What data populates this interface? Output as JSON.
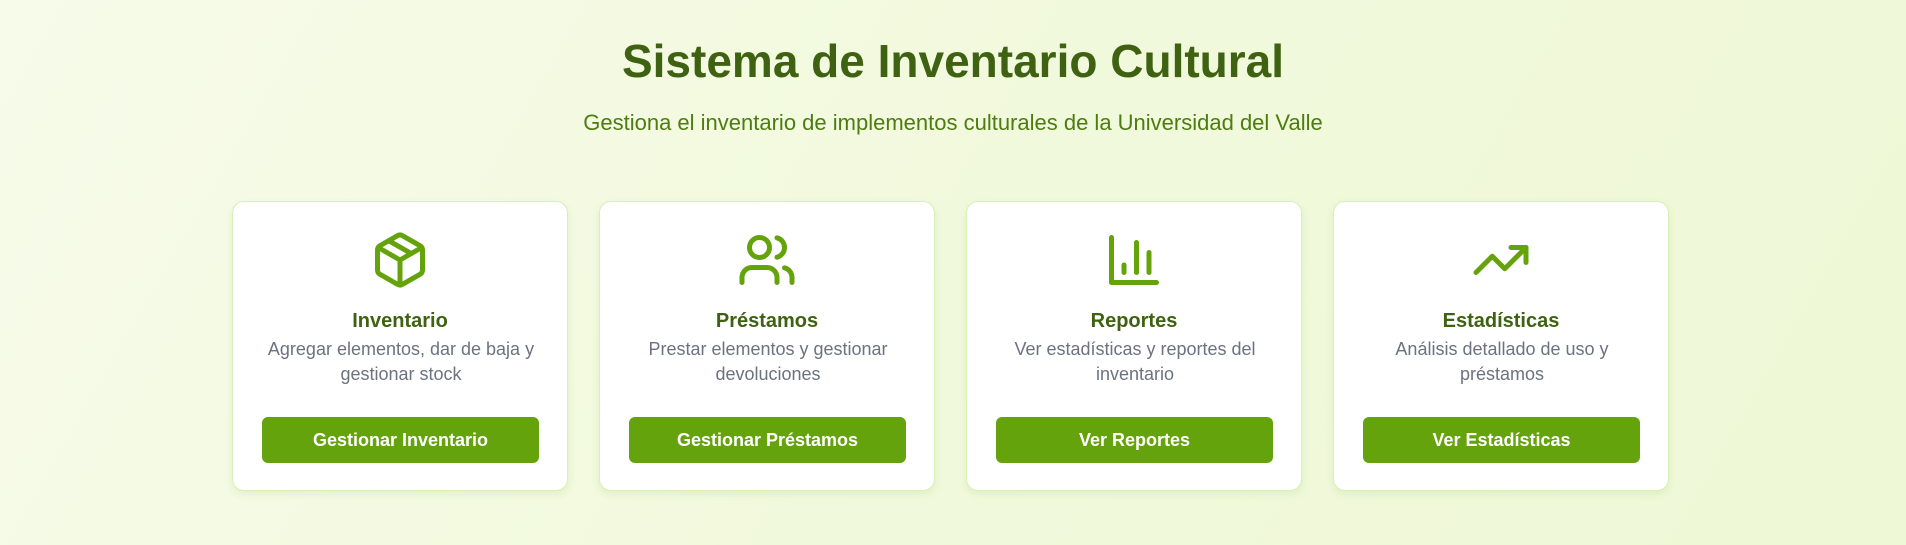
{
  "header": {
    "title": "Sistema de Inventario Cultural",
    "subtitle": "Gestiona el inventario de implementos culturales de la Universidad del Valle"
  },
  "colors": {
    "accent": "#65a30d",
    "heading": "#3f6212",
    "subtitle": "#4d7c0f",
    "body_text": "#6b7280",
    "background": "#f3fae2"
  },
  "cards": [
    {
      "icon": "package-icon",
      "title": "Inventario",
      "description": "Agregar elementos, dar de baja y gestionar stock",
      "button": "Gestionar Inventario"
    },
    {
      "icon": "users-icon",
      "title": "Préstamos",
      "description": "Prestar elementos y gestionar devoluciones",
      "button": "Gestionar Préstamos"
    },
    {
      "icon": "bar-chart-icon",
      "title": "Reportes",
      "description": "Ver estadísticas y reportes del inventario",
      "button": "Ver Reportes"
    },
    {
      "icon": "trending-up-icon",
      "title": "Estadísticas",
      "description": "Análisis detallado de uso y préstamos",
      "button": "Ver Estadísticas"
    }
  ]
}
